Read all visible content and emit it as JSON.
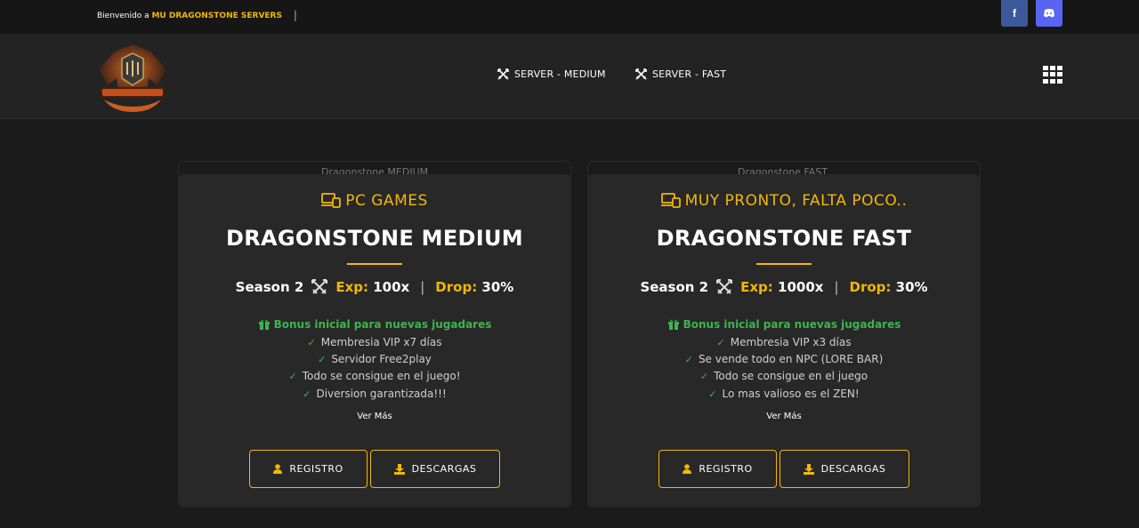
{
  "topbar": {
    "welcome_text": "Bienvenido a",
    "brand_text": "MU DRAGONSTONE SERVERS",
    "separator": "|",
    "facebook_label": "f",
    "discord_label": "d"
  },
  "nav": {
    "items": [
      {
        "label": "SERVER - MEDIUM",
        "icon": "swords-icon"
      },
      {
        "label": "SERVER - FAST",
        "icon": "swords-icon"
      }
    ]
  },
  "colors": {
    "accent": "#f2b705",
    "success": "#3fb34f",
    "card_bg": "#282828",
    "page_bg": "#1b1b1b"
  },
  "cards": [
    {
      "image_alt": "Dragonstone MEDIUM",
      "tag": "PC GAMES",
      "title": "DRAGONSTONE MEDIUM",
      "season": "Season 2",
      "exp_label": "Exp:",
      "exp_value": "100x",
      "drop_label": "Drop:",
      "drop_value": "30%",
      "bonus": "Bonus inicial para nuevas jugadares",
      "features": [
        "Membresia VIP x7 días",
        "Servidor Free2play",
        "Todo se consigue en el juego!",
        "Diversion garantizada!!!"
      ],
      "more": "Ver Más",
      "register_label": "REGISTRO",
      "download_label": "DESCARGAS"
    },
    {
      "image_alt": "Dragonstone FAST",
      "tag": "MUY PRONTO, FALTA POCO..",
      "title": "DRAGONSTONE FAST",
      "season": "Season 2",
      "exp_label": "Exp:",
      "exp_value": "1000x",
      "drop_label": "Drop:",
      "drop_value": "30%",
      "bonus": "Bonus inicial para nuevas jugadares",
      "features": [
        "Membresia VIP x3 días",
        "Se vende todo en NPC (LORE BAR)",
        "Todo se consigue en el juego",
        "Lo mas valioso es el ZEN!"
      ],
      "more": "Ver Más",
      "register_label": "REGISTRO",
      "download_label": "DESCARGAS"
    }
  ]
}
